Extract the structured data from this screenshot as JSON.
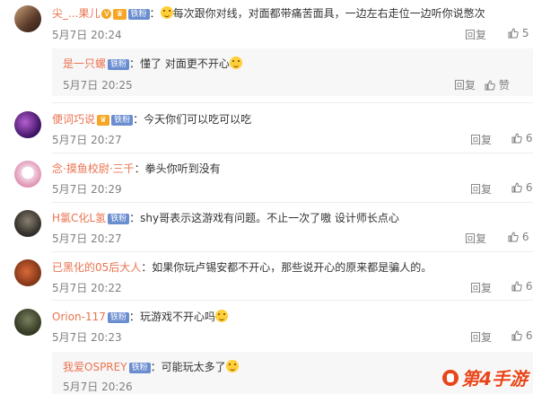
{
  "comments": [
    {
      "username": "尖_...果儿",
      "badge": "铁粉",
      "text": "每次跟你对线，对面都带痛苦面具，一边左右走位一边听你说憋次",
      "date": "5月7日 20:24",
      "reply_label": "回复",
      "like_count": "5"
    },
    {
      "username": "便词巧说",
      "badge": "铁粉",
      "text": "今天你们可以吃可以吃",
      "date": "5月7日 20:27",
      "reply_label": "回复",
      "like_count": "6"
    },
    {
      "username": "念·摸鱼校尉·三千",
      "text": "拳头你听到没有",
      "date": "5月7日 20:29",
      "reply_label": "回复",
      "like_count": "6"
    },
    {
      "username": "H氯C化L氢",
      "badge": "铁粉",
      "text": "shy哥表示这游戏有问题。不止一次了嗷 设计师长点心",
      "date": "5月7日 20:27",
      "reply_label": "回复",
      "like_count": "6"
    },
    {
      "username": "已黑化的05后大人",
      "text": "如果你玩卢锡安都不开心，那些说开心的原来都是骗人的。",
      "date": "5月7日 20:22",
      "reply_label": "回复",
      "like_count": "6"
    },
    {
      "username": "Orion-117",
      "badge": "铁粉",
      "text": "玩游戏不开心吗",
      "date": "5月7日 20:23",
      "reply_label": "回复",
      "like_count": "6"
    }
  ],
  "replies": [
    {
      "username": "是一只螺",
      "badge": "铁粉",
      "text": "懂了 对面更不开心",
      "date": "5月7日 20:25",
      "reply_label": "回复",
      "like_label": "赞"
    },
    {
      "username": "我爱OSPREY",
      "badge": "铁粉",
      "text": "可能玩太多了",
      "date": "5月7日 20:26"
    }
  ],
  "watermark": "第4手游",
  "colors": {
    "username": "#eb7350",
    "badge": "#6a8dd0",
    "muted": "#808080"
  }
}
